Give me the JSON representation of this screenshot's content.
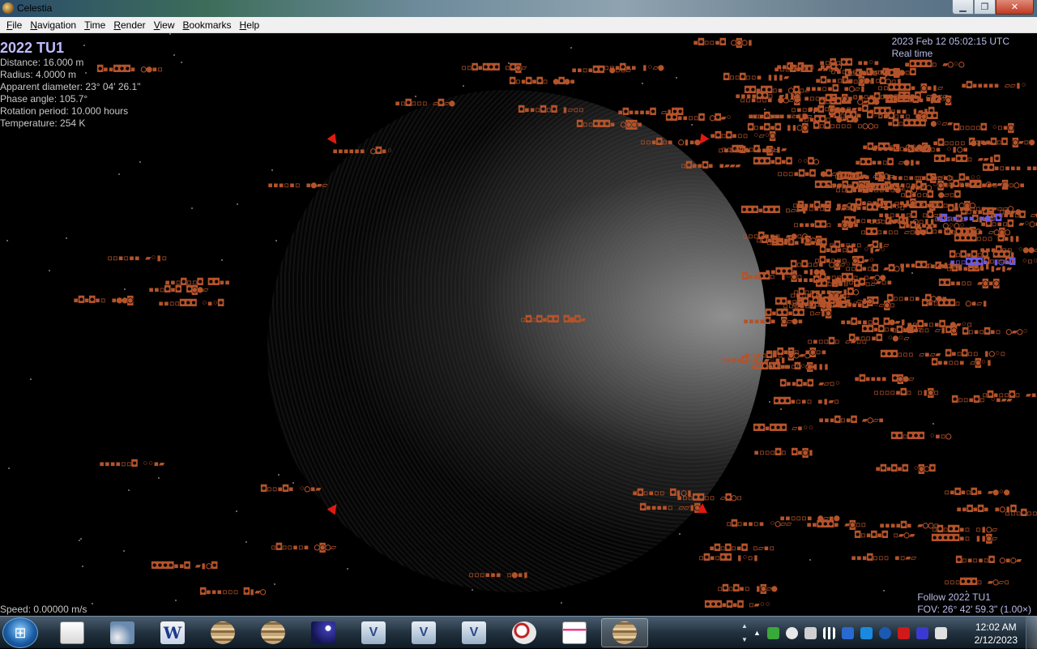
{
  "window": {
    "title": "Celestia",
    "icon": "celestia-app-icon"
  },
  "menu": [
    {
      "accel": "F",
      "rest": "ile"
    },
    {
      "accel": "N",
      "rest": "avigation"
    },
    {
      "accel": "T",
      "rest": "ime"
    },
    {
      "accel": "R",
      "rest": "ender"
    },
    {
      "accel": "V",
      "rest": "iew"
    },
    {
      "accel": "B",
      "rest": "ookmarks"
    },
    {
      "accel": "H",
      "rest": "elp"
    }
  ],
  "info": {
    "object_name": "2022 TU1",
    "distance": "Distance: 16.000 m",
    "radius": "Radius: 4.0000 m",
    "apparent_diameter": "Apparent diameter: 23° 04' 26.1\"",
    "phase_angle": "Phase angle: 105.7°",
    "rotation_period": "Rotation period: 10.000 hours",
    "temperature": "Temperature: 254 K"
  },
  "time": {
    "datetime": "2023 Feb 12 05:02:15 UTC",
    "mode": "Real time"
  },
  "status": {
    "speed": "Speed: 0.00000 m/s",
    "follow": "Follow 2022 TU1",
    "fov": "FOV: 26° 42' 59.3\" (1.00×)"
  },
  "taskbar": {
    "start_icon": "windows-logo-icon",
    "apps": [
      {
        "name": "paint-tool",
        "icon": "ico-doc"
      },
      {
        "name": "photo-app",
        "icon": "ico-bird"
      },
      {
        "name": "word-app",
        "icon": "ico-w"
      },
      {
        "name": "celestia-1",
        "icon": "ico-jupiter"
      },
      {
        "name": "celestia-2",
        "icon": "ico-jupiter"
      },
      {
        "name": "night-sky-app",
        "icon": "ico-night"
      },
      {
        "name": "visual-studio-1",
        "icon": "ico-vs"
      },
      {
        "name": "visual-studio-2",
        "icon": "ico-vs"
      },
      {
        "name": "visual-studio-3",
        "icon": "ico-vs"
      },
      {
        "name": "magnifier-app",
        "icon": "ico-mag"
      },
      {
        "name": "notepad-app",
        "icon": "ico-note"
      },
      {
        "name": "celestia-active",
        "icon": "ico-jupiter"
      }
    ],
    "clock_time": "12:02 AM",
    "clock_date": "2/12/2023"
  },
  "colors": {
    "label_orange": "#b4532a",
    "label_blue": "#6a5ae0",
    "info_name": "#bcbcff",
    "marker_red": "#e01a10"
  }
}
